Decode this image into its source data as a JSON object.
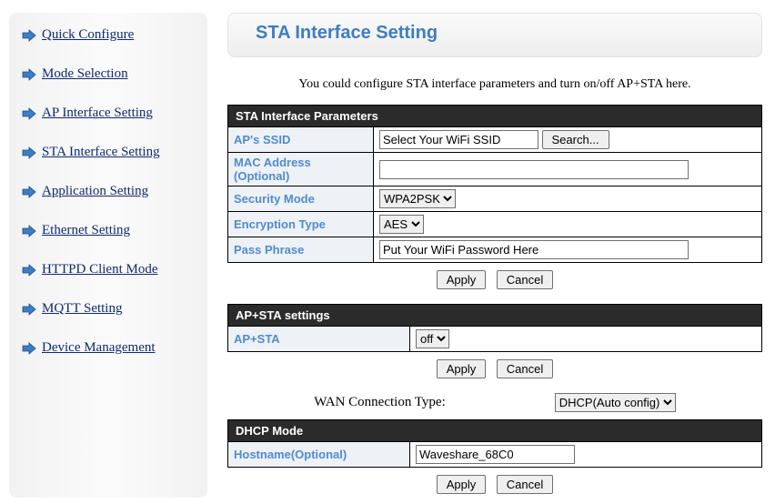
{
  "sidebar": {
    "items": [
      {
        "label": "Quick Configure"
      },
      {
        "label": "Mode Selection"
      },
      {
        "label": "AP Interface Setting"
      },
      {
        "label": "STA Interface Setting"
      },
      {
        "label": "Application Setting"
      },
      {
        "label": "Ethernet Setting"
      },
      {
        "label": "HTTPD Client Mode"
      },
      {
        "label": "MQTT Setting"
      },
      {
        "label": "Device Management"
      }
    ]
  },
  "page": {
    "title": "STA Interface Setting",
    "description": "You could configure STA interface parameters and turn on/off AP+STA here."
  },
  "sta_params": {
    "caption": "STA Interface Parameters",
    "ssid_label": "AP's SSID",
    "ssid_value": "Select Your WiFi SSID",
    "search_btn": "Search...",
    "mac_label": "MAC Address (Optional)",
    "mac_value": "",
    "security_label": "Security Mode",
    "security_value": "WPA2PSK",
    "encryption_label": "Encryption Type",
    "encryption_value": "AES",
    "pass_label": "Pass Phrase",
    "pass_value": "Put Your WiFi Password Here",
    "apply": "Apply",
    "cancel": "Cancel"
  },
  "apsta": {
    "caption": "AP+STA settings",
    "label": "AP+STA",
    "value": "off",
    "apply": "Apply",
    "cancel": "Cancel"
  },
  "wan": {
    "label": "WAN Connection Type:",
    "value": "DHCP(Auto config)"
  },
  "dhcp": {
    "caption": "DHCP Mode",
    "hostname_label": "Hostname(Optional)",
    "hostname_value": "Waveshare_68C0",
    "apply": "Apply",
    "cancel": "Cancel"
  }
}
